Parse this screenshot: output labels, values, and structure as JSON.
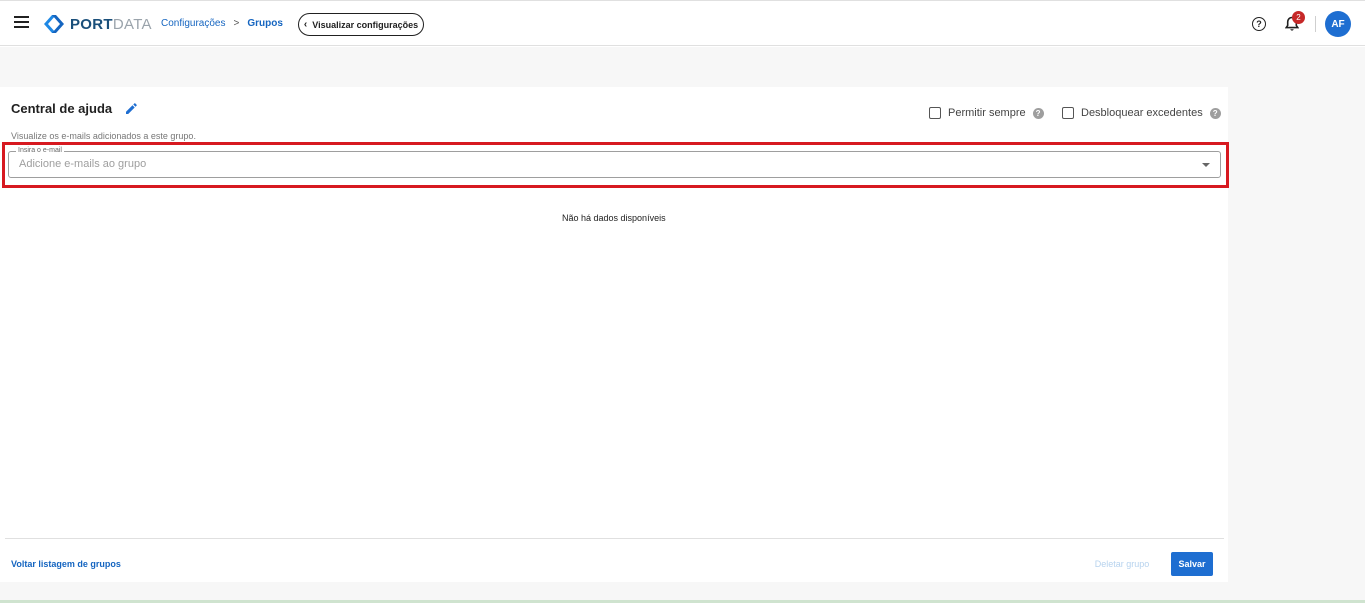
{
  "header": {
    "logo_port": "PORT",
    "logo_data": "DATA",
    "breadcrumb": {
      "parent": "Configurações",
      "separator": ">",
      "current": "Grupos"
    },
    "back_button_label": "Visualizar configurações",
    "notification_count": "2",
    "avatar_initials": "AF"
  },
  "group": {
    "title": "Central de ajuda",
    "subtitle": "Visualize os e-mails adicionados a este grupo.",
    "options": {
      "allow_always_label": "Permitir sempre",
      "allow_always_checked": false,
      "unlock_excess_label": "Desbloquear excedentes",
      "unlock_excess_checked": false
    },
    "email_field": {
      "label": "Insira o e-mail",
      "placeholder": "Adicione e-mails ao grupo",
      "value": ""
    },
    "empty_message": "Não há dados disponíveis"
  },
  "footer": {
    "back_link": "Voltar listagem de grupos",
    "delete_label": "Deletar grupo",
    "save_label": "Salvar"
  },
  "colors": {
    "primary": "#1e6ed1",
    "link": "#1565c0",
    "highlight": "#d71920",
    "badge": "#c62828",
    "disabled_text": "#b7d3ee"
  }
}
